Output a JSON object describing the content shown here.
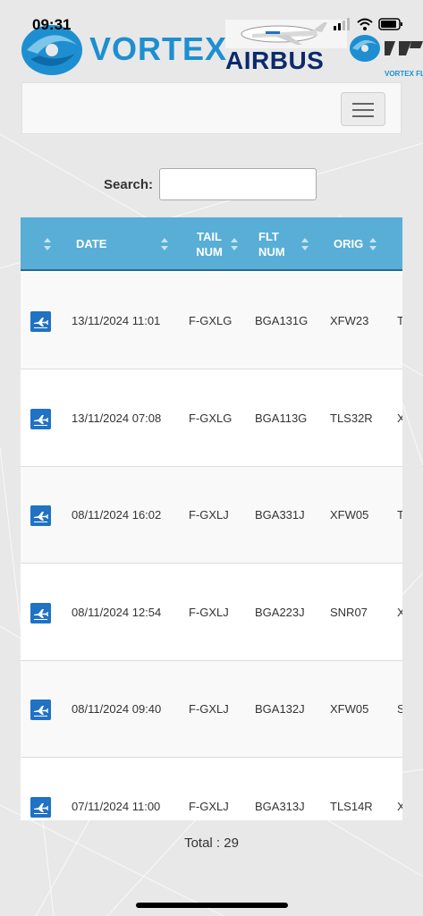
{
  "status_bar": {
    "time": "09:31"
  },
  "header": {
    "vortex_word": "VORTEX",
    "airbus_word": "AIRBUS",
    "vortex_flight_label": "VORTEX FLI"
  },
  "search": {
    "label": "Search:",
    "value": "",
    "placeholder": ""
  },
  "table": {
    "columns": [
      {
        "label": ""
      },
      {
        "label": "DATE"
      },
      {
        "label": "TAIL NUM"
      },
      {
        "label": "FLT NUM"
      },
      {
        "label": "ORIG"
      }
    ],
    "rows": [
      {
        "date": "13/11/2024 11:01",
        "tail": "F-GXLG",
        "flt": "BGA131G",
        "orig": "XFW23",
        "next": "T"
      },
      {
        "date": "13/11/2024 07:08",
        "tail": "F-GXLG",
        "flt": "BGA113G",
        "orig": "TLS32R",
        "next": "X"
      },
      {
        "date": "08/11/2024 16:02",
        "tail": "F-GXLJ",
        "flt": "BGA331J",
        "orig": "XFW05",
        "next": "T"
      },
      {
        "date": "08/11/2024 12:54",
        "tail": "F-GXLJ",
        "flt": "BGA223J",
        "orig": "SNR07",
        "next": "X"
      },
      {
        "date": "08/11/2024 09:40",
        "tail": "F-GXLJ",
        "flt": "BGA132J",
        "orig": "XFW05",
        "next": "S"
      },
      {
        "date": "07/11/2024 11:00",
        "tail": "F-GXLJ",
        "flt": "BGA313J",
        "orig": "TLS14R",
        "next": "X"
      }
    ]
  },
  "footer": {
    "total": "Total : 29"
  },
  "colors": {
    "header_bg": "#58aed6",
    "icon_blue": "#1f72c4",
    "brand_blue": "#1d8fd0",
    "airbus_navy": "#0a2a6b"
  },
  "icons": [
    "plane-icon",
    "sort-icon",
    "menu-icon",
    "wifi-icon",
    "signal-icon",
    "battery-icon"
  ]
}
